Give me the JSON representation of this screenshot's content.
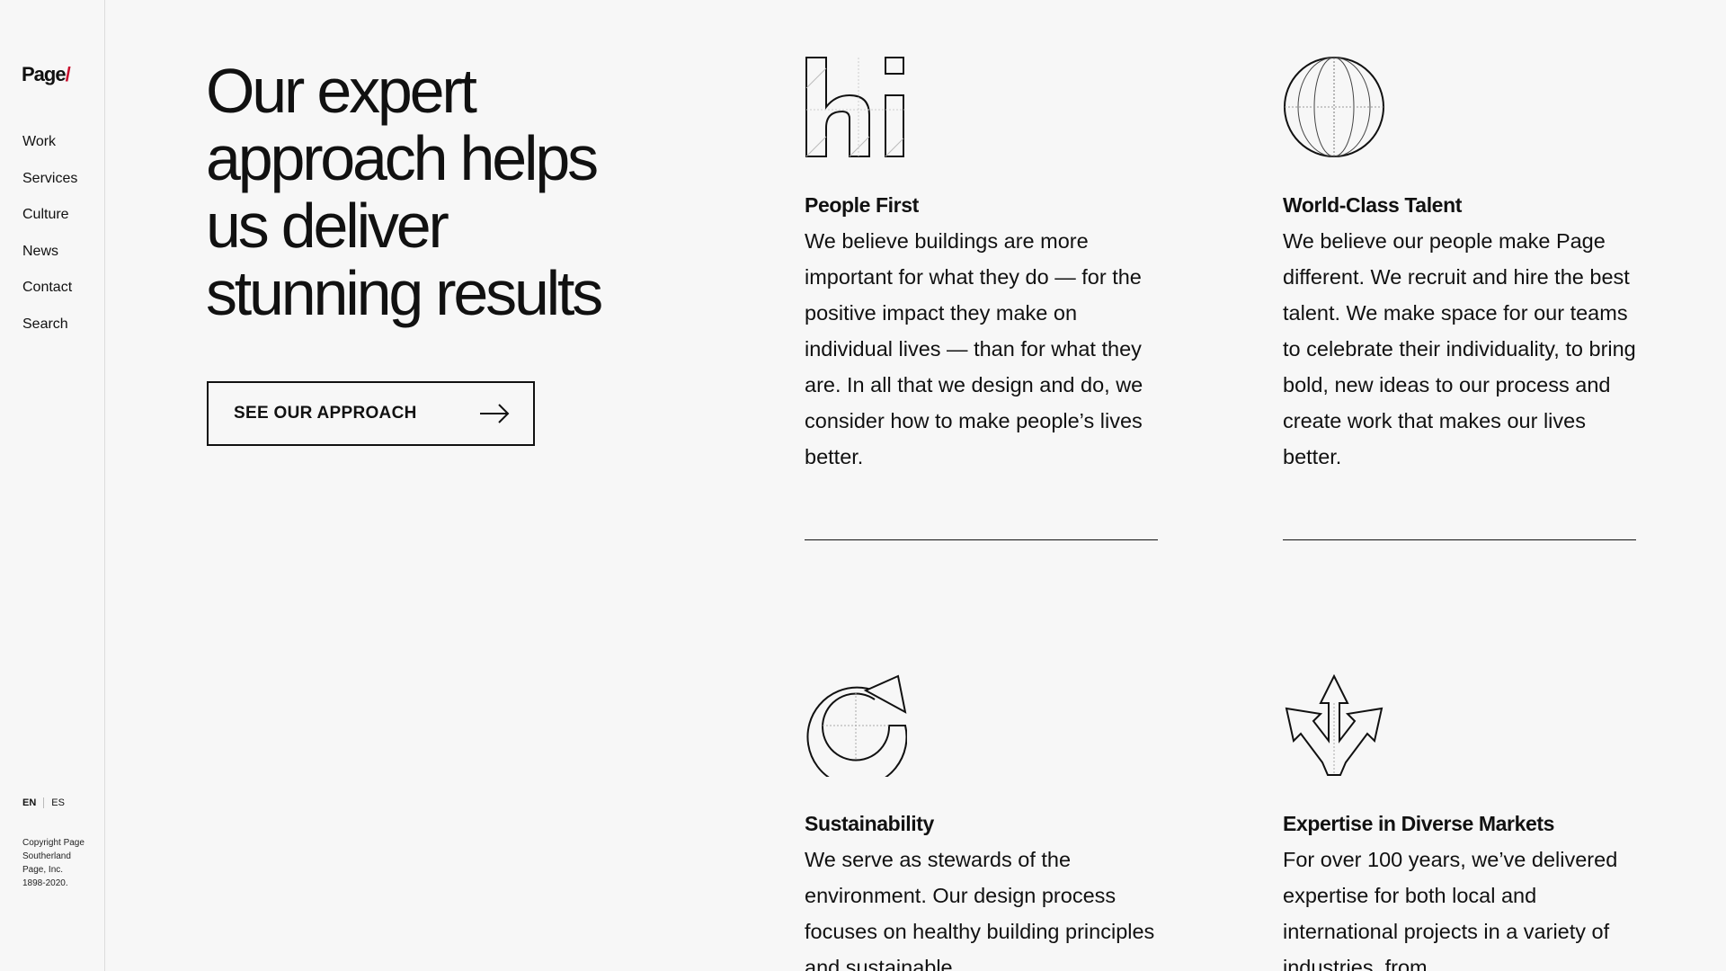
{
  "brand": {
    "name": "Page",
    "slash": "/"
  },
  "nav": {
    "items": [
      "Work",
      "Services",
      "Culture",
      "News",
      "Contact",
      "Search"
    ]
  },
  "language": {
    "active": "EN",
    "other": "ES"
  },
  "copyright": "Copyright Page Southerland Page, Inc. 1898-2020.",
  "hero": {
    "heading": "Our expert approach helps us deliver stunning results",
    "cta_label": "SEE OUR APPROACH",
    "cta_icon": "arrow-right-icon"
  },
  "features": [
    {
      "icon": "hi-letters-icon",
      "title": "People First",
      "body": "We believe buildings are more important for what they do — for the positive impact they make on individual lives — than for what they are. In all that we design and do, we consider how to make people’s lives better."
    },
    {
      "icon": "globe-icon",
      "title": "World-Class Talent",
      "body": "We believe our people make Page different. We recruit and hire the best talent. We make space for our teams to celebrate their individuality, to bring bold, new ideas to our process and create work that makes our lives better."
    },
    {
      "icon": "recycle-arrow-icon",
      "title": "Sustainability",
      "body": "We serve as stewards of the environment. Our design process focuses on healthy building principles and sustainable"
    },
    {
      "icon": "diverging-arrows-icon",
      "title": "Expertise in Diverse Markets",
      "body": "For over 100 years, we’ve delivered expertise for both local and international projects in a variety of industries, from"
    }
  ],
  "colors": {
    "accent": "#c8102e",
    "text": "#111111",
    "background": "#f7f7f7"
  }
}
